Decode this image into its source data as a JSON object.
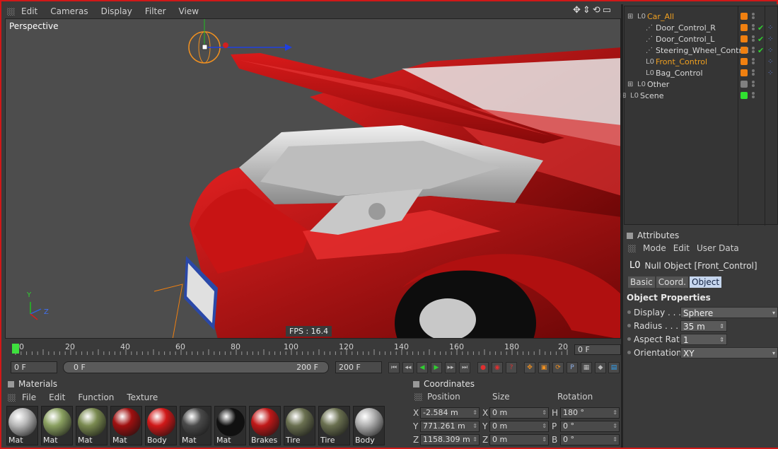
{
  "viewport_menu": [
    "Edit",
    "Cameras",
    "Display",
    "Filter",
    "View"
  ],
  "viewport": {
    "label": "Perspective",
    "fps": "FPS : 16.4",
    "axis_y": "Y",
    "axis_z": "Z"
  },
  "object_manager": {
    "items": [
      {
        "name": "Car_All",
        "icon": "null-icon",
        "tag_color": "#f08010",
        "selected": true
      },
      {
        "name": "Door_Control_R",
        "icon": "spline-icon",
        "tag_color": "#f08010",
        "check": true
      },
      {
        "name": "Door_Control_L",
        "icon": "spline-icon",
        "tag_color": "#f08010",
        "check": true
      },
      {
        "name": "Steering_Wheel_Control",
        "icon": "spline-icon",
        "tag_color": "#f08010",
        "check": true
      },
      {
        "name": "Front_Control",
        "icon": "null-icon",
        "tag_color": "#f08010",
        "selected": true
      },
      {
        "name": "Bag_Control",
        "icon": "null-icon",
        "tag_color": "#f08010"
      },
      {
        "name": "Other",
        "icon": "null-icon",
        "tag_color": "#808080"
      },
      {
        "name": "Scene",
        "icon": "null-icon",
        "tag_color": "#30e030"
      }
    ]
  },
  "attributes": {
    "title": "Attributes",
    "menu": [
      "Mode",
      "Edit",
      "User Data"
    ],
    "object_title": "Null Object [Front_Control]",
    "tabs": [
      "Basic",
      "Coord.",
      "Object"
    ],
    "active_tab": "Object",
    "section": "Object Properties",
    "props": [
      {
        "label": "Display . . . .",
        "value": "Sphere"
      },
      {
        "label": "Radius . . . .",
        "value": "35 m"
      },
      {
        "label": "Aspect Ratio",
        "value": "1"
      },
      {
        "label": "Orientation",
        "value": "XY"
      }
    ]
  },
  "timeline": {
    "ticks": [
      "0",
      "20",
      "40",
      "60",
      "80",
      "100",
      "120",
      "140",
      "160",
      "180",
      "20"
    ],
    "current_frame": "0 F"
  },
  "transport": {
    "start": "0 F",
    "range_start": "0 F",
    "range_end": "200 F",
    "end": "200 F"
  },
  "materials": {
    "title": "Materials",
    "menu": [
      "File",
      "Edit",
      "Function",
      "Texture"
    ],
    "items": [
      {
        "label": "Mat",
        "color": "#b8b8b8"
      },
      {
        "label": "Mat",
        "color": "#8aa060"
      },
      {
        "label": "Mat",
        "color": "#7a8a50"
      },
      {
        "label": "Mat",
        "color": "#a01010"
      },
      {
        "label": "Body",
        "color": "#d01818"
      },
      {
        "label": "Mat",
        "color": "#4a4a4a"
      },
      {
        "label": "Mat",
        "color": "#101010"
      },
      {
        "label": "Brakes",
        "color": "#c01818"
      },
      {
        "label": "Tire",
        "color": "#6a7050"
      },
      {
        "label": "Tire",
        "color": "#6a7050"
      },
      {
        "label": "Body",
        "color": "#b0b0b0"
      }
    ]
  },
  "coordinates": {
    "title": "Coordinates",
    "headers": [
      "Position",
      "Size",
      "Rotation"
    ],
    "rows": [
      {
        "p_axis": "X",
        "p": "-2.584 m",
        "s_axis": "X",
        "s": "0 m",
        "r_axis": "H",
        "r": "180 °"
      },
      {
        "p_axis": "Y",
        "p": "771.261 m",
        "s_axis": "Y",
        "s": "0 m",
        "r_axis": "P",
        "r": "0 °"
      },
      {
        "p_axis": "Z",
        "p": "1158.309 m",
        "s_axis": "Z",
        "s": "0 m",
        "r_axis": "B",
        "r": "0 °"
      }
    ]
  }
}
